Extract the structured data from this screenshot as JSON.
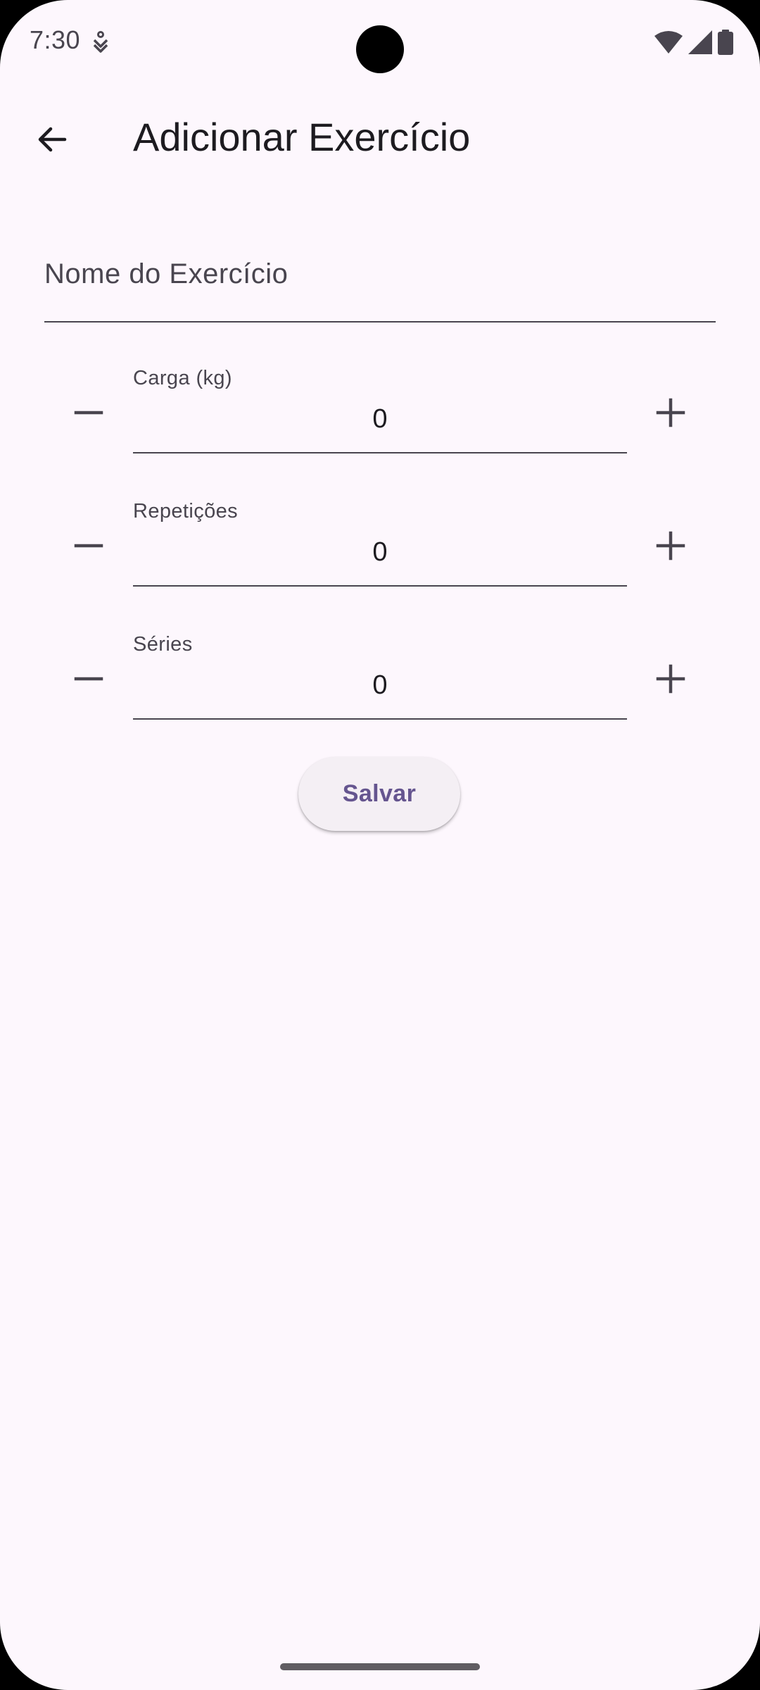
{
  "status_bar": {
    "time": "7:30",
    "notification_icon": "accessibility-service-icon",
    "wifi_icon": "wifi-icon",
    "signal_icon": "cell-signal-icon",
    "battery_icon": "battery-icon"
  },
  "app_bar": {
    "back_icon": "arrow-back-icon",
    "title": "Adicionar Exercício"
  },
  "form": {
    "name_field": {
      "placeholder": "Nome do Exercício",
      "value": ""
    },
    "steppers": [
      {
        "label": "Carga (kg)",
        "value": "0",
        "minus_icon": "minus-icon",
        "plus_icon": "plus-icon"
      },
      {
        "label": "Repetições",
        "value": "0",
        "minus_icon": "minus-icon",
        "plus_icon": "plus-icon"
      },
      {
        "label": "Séries",
        "value": "0",
        "minus_icon": "minus-icon",
        "plus_icon": "plus-icon"
      }
    ],
    "save_label": "Salvar"
  },
  "colors": {
    "background": "#fdf7fd",
    "primary": "#65558f",
    "on_surface": "#1d1b20",
    "on_surface_variant": "#49454f",
    "button_surface": "#f4eff4"
  }
}
